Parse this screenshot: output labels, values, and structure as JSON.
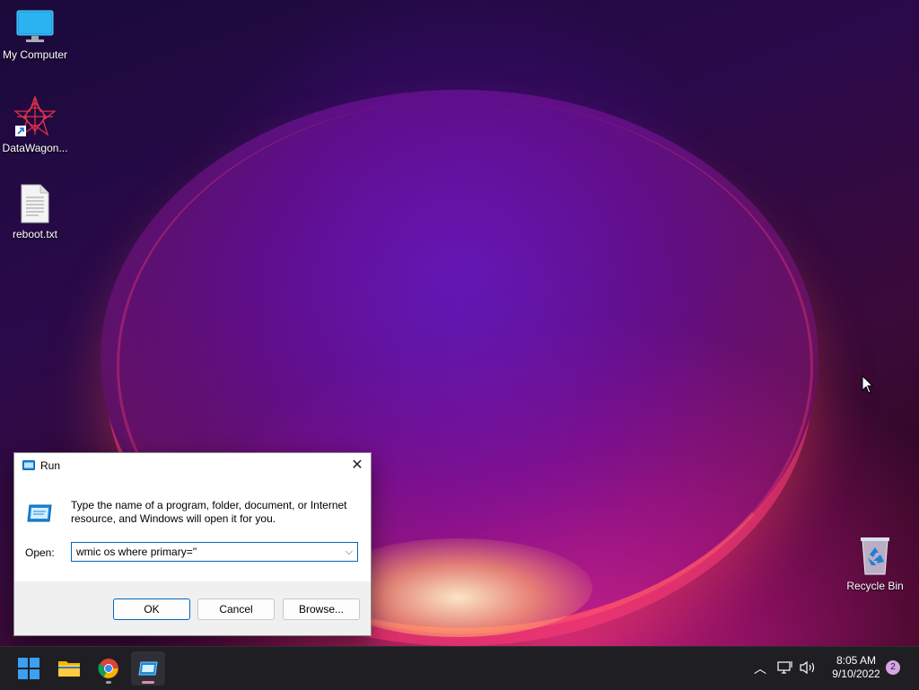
{
  "desktop": {
    "icons": [
      {
        "label": "My Computer",
        "icon": "monitor-icon"
      },
      {
        "label": "DataWagon...",
        "icon": "datawagon-icon"
      },
      {
        "label": "reboot.txt",
        "icon": "text-file-icon"
      },
      {
        "label": "Recycle Bin",
        "icon": "recycle-bin-icon"
      }
    ]
  },
  "run_dialog": {
    "title": "Run",
    "description": "Type the name of a program, folder, document, or Internet resource, and Windows will open it for you.",
    "open_label": "Open:",
    "open_value": "wmic os where primary=''",
    "ok_label": "OK",
    "cancel_label": "Cancel",
    "browse_label": "Browse..."
  },
  "taskbar": {
    "apps": [
      "start-icon",
      "file-explorer-icon",
      "chrome-icon",
      "run-icon"
    ],
    "active_app": "run-icon",
    "time": "8:05 AM",
    "date": "9/10/2022",
    "notification_count": "2"
  }
}
